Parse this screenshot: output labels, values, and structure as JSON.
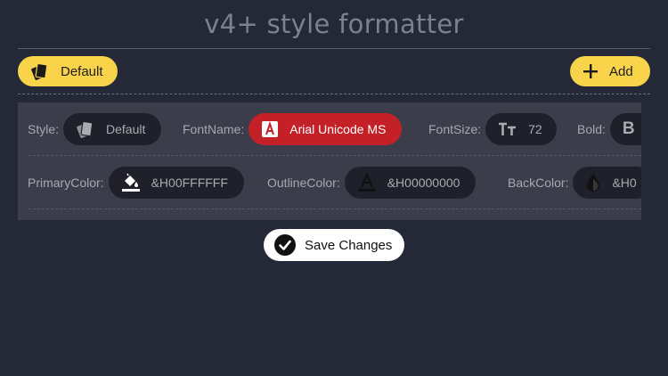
{
  "header": {
    "title": "v4+ style formatter"
  },
  "toolbar": {
    "default_label": "Default",
    "add_label": "Add"
  },
  "rows": [
    {
      "fields": [
        {
          "label": "Style:",
          "value": "Default",
          "icon": "cards-icon"
        },
        {
          "label": "FontName:",
          "value": "Arial Unicode MS",
          "icon": "font-a-icon",
          "highlight": true
        },
        {
          "label": "FontSize:",
          "value": "72",
          "icon": "text-size-icon"
        },
        {
          "label": "Bold:",
          "value": "B",
          "icon": "bold-icon"
        }
      ]
    },
    {
      "fields": [
        {
          "label": "PrimaryColor:",
          "value": "&H00FFFFFF",
          "icon": "paint-bucket-icon"
        },
        {
          "label": "OutlineColor:",
          "value": "&H00000000",
          "icon": "text-color-icon"
        },
        {
          "label": "BackColor:",
          "value": "&H0",
          "icon": "drop-icon"
        }
      ]
    }
  ],
  "footer": {
    "save_label": "Save Changes"
  },
  "colors": {
    "accent": "#f9d349",
    "highlight": "#c42027",
    "background": "#252836",
    "panel": "#3b3e4a"
  }
}
